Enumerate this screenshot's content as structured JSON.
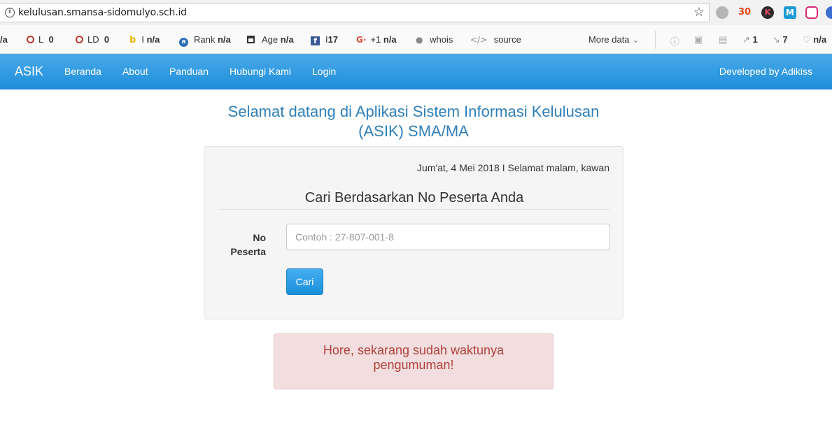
{
  "browser": {
    "url": "kelulusan.smansa-sidomulyo.sch.id",
    "extensions": [
      "dice-icon",
      "seo-30-icon",
      "k-icon",
      "m-icon",
      "instagram-icon",
      "chrome-icon"
    ]
  },
  "seo_toolbar": {
    "items": [
      {
        "label": "",
        "value": "/a"
      },
      {
        "label": "L",
        "value": "0"
      },
      {
        "label": "LD",
        "value": "0"
      },
      {
        "label": "I",
        "value": "n/a"
      },
      {
        "label": "Rank",
        "value": "n/a"
      },
      {
        "label": "Age",
        "value": "n/a"
      },
      {
        "label": "I",
        "value": "17"
      },
      {
        "label": "+1",
        "value": "n/a"
      },
      {
        "label": "whois",
        "value": ""
      },
      {
        "label": "source",
        "value": ""
      }
    ],
    "more_data": "More data",
    "right_items": [
      {
        "label": "",
        "value": ""
      },
      {
        "label": "",
        "value": ""
      },
      {
        "label": "",
        "value": ""
      },
      {
        "label": "",
        "value": "1"
      },
      {
        "label": "",
        "value": "7"
      },
      {
        "label": "",
        "value": "n/a"
      }
    ]
  },
  "navbar": {
    "brand": "ASIK",
    "links": [
      "Beranda",
      "About",
      "Panduan",
      "Hubungi Kami",
      "Login"
    ],
    "developer": "Developed by Adikiss",
    "gradient_top": "#4aa9e8",
    "gradient_bottom": "#1f8fdc"
  },
  "main": {
    "title": "Selamat datang di Aplikasi Sistem Informasi Kelulusan (ASIK) SMA/MA",
    "date_line": "Jum'at, 4 Mei 2018 I Selamat malam, kawan",
    "panel_heading": "Cari Berdasarkan No Peserta Anda",
    "field_label": "No Peserta",
    "field_placeholder": "Contoh : 27-807-001-8",
    "field_value": "",
    "search_button": "Cari",
    "alert_text": "Hore, sekarang sudah waktunya pengumuman!"
  }
}
